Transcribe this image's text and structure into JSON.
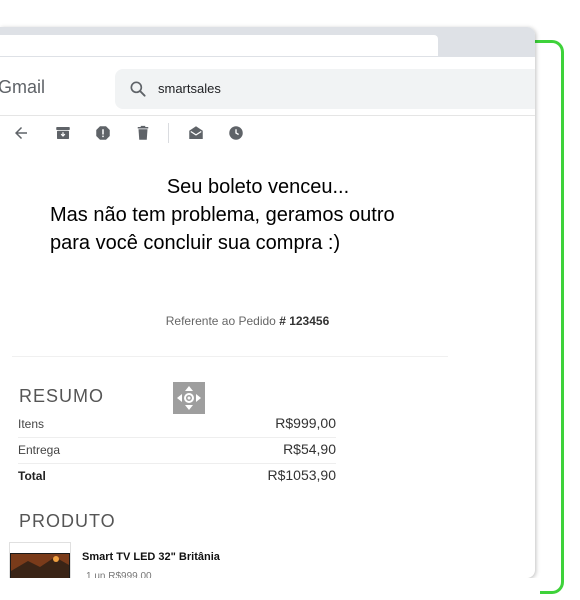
{
  "header": {
    "app_name": "Gmail",
    "search_query": "smartsales"
  },
  "email": {
    "headline_line1": "Seu boleto venceu...",
    "headline_line2": "Mas não tem problema, geramos outro",
    "headline_line3": "para você concluir sua compra :)",
    "order_ref_prefix": "Referente ao Pedido",
    "order_number": "# 123456",
    "summary": {
      "title": "RESUMO",
      "rows": [
        {
          "label": "Itens",
          "value": "R$999,00"
        },
        {
          "label": "Entrega",
          "value": "R$54,90"
        },
        {
          "label": "Total",
          "value": "R$1053,90"
        }
      ]
    },
    "product": {
      "title": "PRODUTO",
      "name": "Smart TV LED 32\" Britânia",
      "qty": "1 un R$999,00"
    }
  },
  "colors": {
    "frame_green": "#3ed23a",
    "search_bg": "#f1f3f4"
  }
}
